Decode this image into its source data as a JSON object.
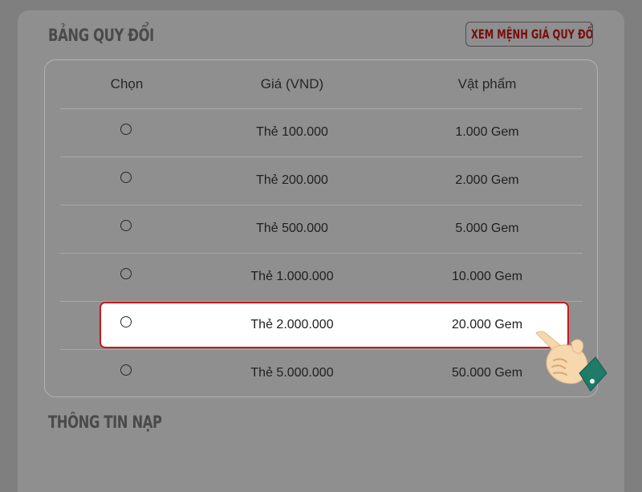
{
  "header": {
    "title": "BẢNG QUY ĐỔI",
    "view_button": "XEM MỆNH GIÁ QUY ĐỔI"
  },
  "table": {
    "columns": [
      "Chọn",
      "Giá (VND)",
      "Vật phẩm"
    ],
    "rows": [
      {
        "price": "Thẻ 100.000",
        "item": "1.000 Gem",
        "selected": false
      },
      {
        "price": "Thẻ 200.000",
        "item": "2.000 Gem",
        "selected": false
      },
      {
        "price": "Thẻ 500.000",
        "item": "5.000 Gem",
        "selected": false
      },
      {
        "price": "Thẻ 1.000.000",
        "item": "10.000 Gem",
        "selected": false
      },
      {
        "price": "Thẻ 2.000.000",
        "item": "20.000 Gem",
        "selected": false
      },
      {
        "price": "Thẻ 5.000.000",
        "item": "50.000 Gem",
        "selected": false
      }
    ],
    "highlighted_row": 4
  },
  "section2": {
    "title": "THÔNG TIN NẠP"
  },
  "colors": {
    "overlay": "#7f7f7f",
    "highlight_border": "#c8191c",
    "button_text": "#7a0c0c",
    "cuff": "#1f7a68"
  },
  "icons": {
    "pointer": "hand-pointer-icon",
    "radio": "radio-button-icon"
  }
}
